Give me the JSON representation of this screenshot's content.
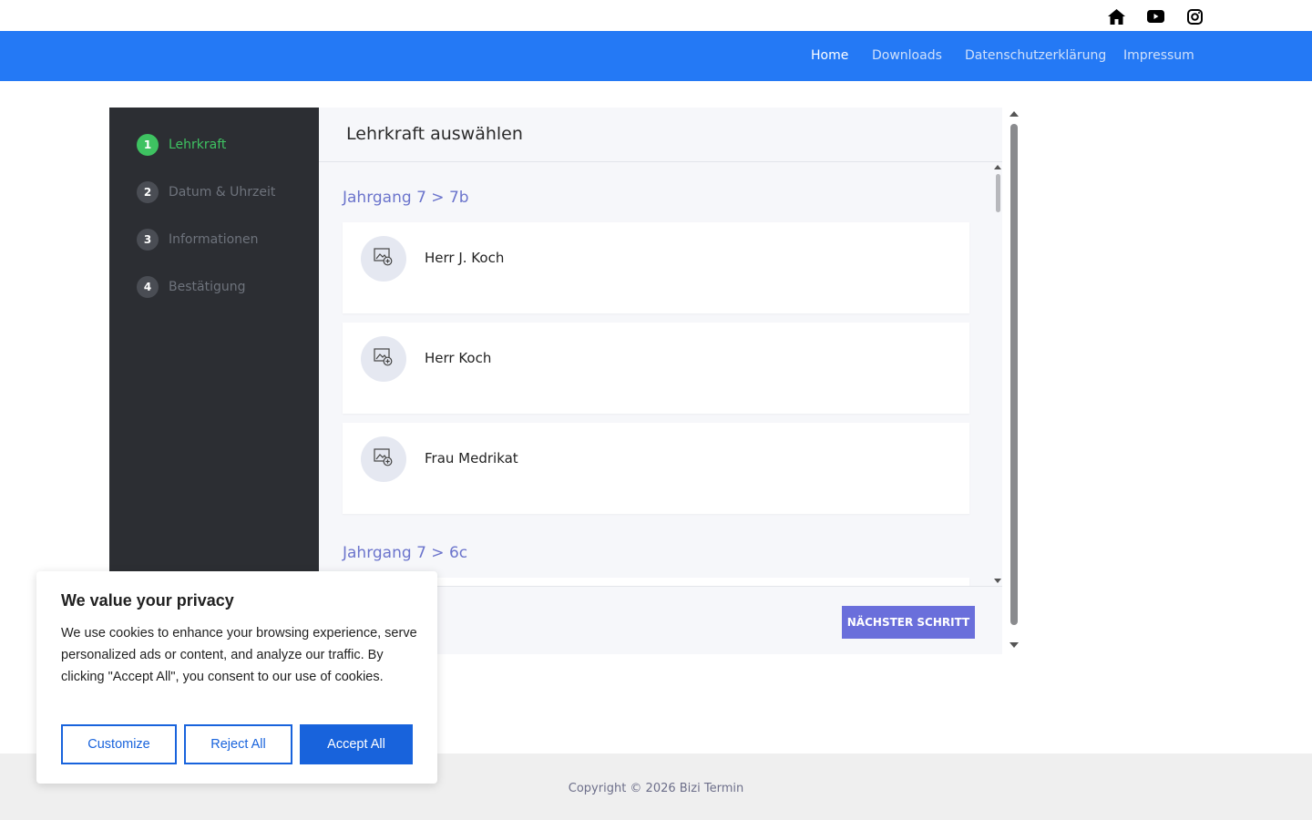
{
  "nav": {
    "items": [
      {
        "label": "Home",
        "active": true
      },
      {
        "label": "Downloads",
        "active": false
      },
      {
        "label": "Datenschutzerklärung",
        "active": false
      },
      {
        "label": "Impressum",
        "active": false
      }
    ],
    "social_icons": [
      "home-icon",
      "youtube-icon",
      "instagram-icon"
    ],
    "bar_color": "#2479f5"
  },
  "sidebar": {
    "steps": [
      {
        "num": "1",
        "label": "Lehrkraft",
        "active": true
      },
      {
        "num": "2",
        "label": "Datum & Uhrzeit",
        "active": false
      },
      {
        "num": "3",
        "label": "Informationen",
        "active": false
      },
      {
        "num": "4",
        "label": "Bestätigung",
        "active": false
      }
    ],
    "active_color": "#3ec261"
  },
  "panel": {
    "title": "Lehrkraft auswählen",
    "groups": [
      {
        "title": "Jahrgang 7 > 7b",
        "teachers": [
          "Herr J. Koch",
          "Herr Koch",
          "Frau Medrikat"
        ]
      },
      {
        "title": "Jahrgang 7 > 6c",
        "teachers": []
      }
    ],
    "next_label": "NÄCHSTER SCHRITT",
    "accent": "#6a6fdb"
  },
  "footer": {
    "copyright": "Copyright © 2026 Bizi Termin"
  },
  "cookie": {
    "title": "We value your privacy",
    "text": "We use cookies to enhance your browsing experience, serve personalized ads or content, and analyze our traffic. By clicking \"Accept All\", you consent to our use of cookies.",
    "customize_label": "Customize",
    "reject_label": "Reject All",
    "accept_label": "Accept All",
    "button_color": "#1863dc"
  }
}
